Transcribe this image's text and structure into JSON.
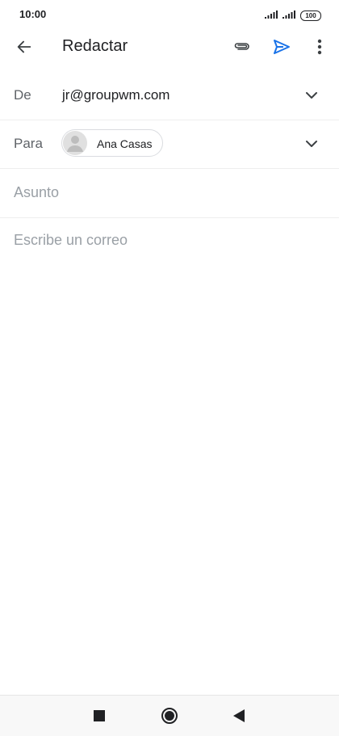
{
  "status": {
    "time": "10:00",
    "battery": "100",
    "icons": [
      "signal-icon",
      "signal-icon",
      "battery-icon"
    ]
  },
  "app_bar": {
    "title": "Redactar",
    "icons": [
      "back-arrow-icon",
      "attach-icon",
      "send-icon",
      "more-vert-icon"
    ],
    "accent_color": "#1a73e8"
  },
  "compose": {
    "from_label": "De",
    "from_value": "jr@groupwm.com",
    "to_label": "Para",
    "recipient_chip": "Ana Casas",
    "subject_placeholder": "Asunto",
    "body_placeholder": "Escribe un correo"
  },
  "nav": {
    "icons": [
      "recents-square-icon",
      "home-circle-icon",
      "back-triangle-icon"
    ]
  }
}
